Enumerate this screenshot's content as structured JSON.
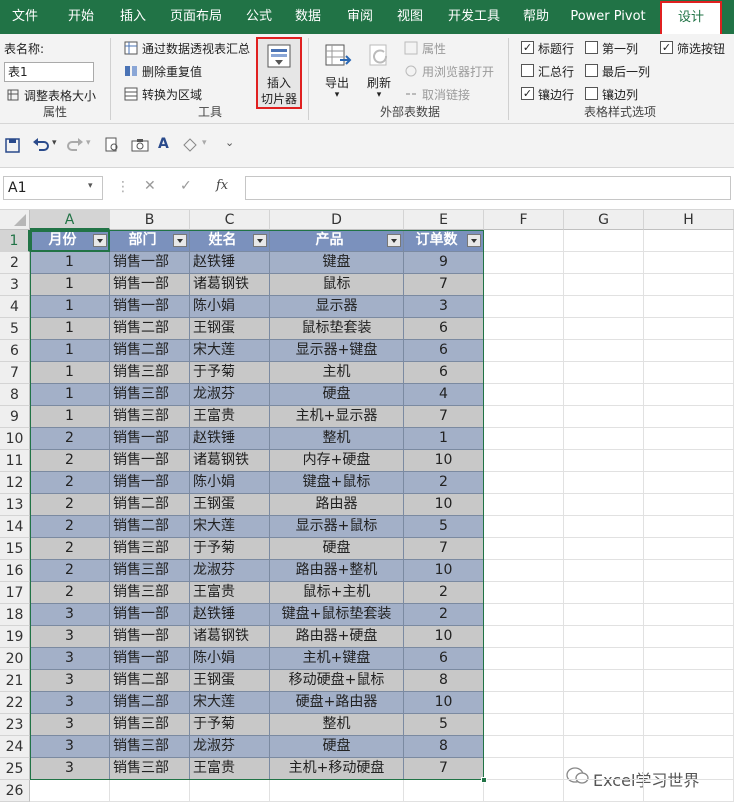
{
  "tabs": [
    "文件",
    "开始",
    "插入",
    "页面布局",
    "公式",
    "数据",
    "审阅",
    "视图",
    "开发工具",
    "帮助",
    "Power Pivot",
    "设计"
  ],
  "active_tab": "设计",
  "ribbon": {
    "properties": {
      "name_label": "表名称:",
      "table_name": "表1",
      "resize": "调整表格大小",
      "group": "属性"
    },
    "tools": {
      "pivot": "通过数据透视表汇总",
      "remove_dup": "删除重复值",
      "convert": "转换为区域",
      "slicer_line1": "插入",
      "slicer_line2": "切片器",
      "group": "工具"
    },
    "external": {
      "export": "导出",
      "refresh": "刷新",
      "properties": "属性",
      "open_browser": "用浏览器打开",
      "unlink": "取消链接",
      "group": "外部表数据"
    },
    "style_options": {
      "items": [
        {
          "label": "标题行",
          "checked": true
        },
        {
          "label": "第一列",
          "checked": false
        },
        {
          "label": "筛选按钮",
          "checked": true
        },
        {
          "label": "汇总行",
          "checked": false
        },
        {
          "label": "最后一列",
          "checked": false
        },
        {
          "label": "镶边行",
          "checked": true
        },
        {
          "label": "镶边列",
          "checked": false
        }
      ],
      "group": "表格样式选项"
    }
  },
  "namebox": "A1",
  "formula_buttons": {
    "cancel": "✕",
    "enter": "✓",
    "fx": "fx"
  },
  "columns": [
    "A",
    "B",
    "C",
    "D",
    "E",
    "F",
    "G",
    "H"
  ],
  "table": {
    "headers": [
      "月份",
      "部门",
      "姓名",
      "产品",
      "订单数"
    ],
    "rows": [
      [
        "1",
        "销售一部",
        "赵铁锤",
        "键盘",
        "9"
      ],
      [
        "1",
        "销售一部",
        "诸葛钢铁",
        "鼠标",
        "7"
      ],
      [
        "1",
        "销售一部",
        "陈小娟",
        "显示器",
        "3"
      ],
      [
        "1",
        "销售二部",
        "王钢蛋",
        "鼠标垫套装",
        "6"
      ],
      [
        "1",
        "销售二部",
        "宋大莲",
        "显示器+键盘",
        "6"
      ],
      [
        "1",
        "销售三部",
        "于予菊",
        "主机",
        "6"
      ],
      [
        "1",
        "销售三部",
        "龙淑芬",
        "硬盘",
        "4"
      ],
      [
        "1",
        "销售三部",
        "王富贵",
        "主机+显示器",
        "7"
      ],
      [
        "2",
        "销售一部",
        "赵铁锤",
        "整机",
        "1"
      ],
      [
        "2",
        "销售一部",
        "诸葛钢铁",
        "内存+硬盘",
        "10"
      ],
      [
        "2",
        "销售一部",
        "陈小娟",
        "键盘+鼠标",
        "2"
      ],
      [
        "2",
        "销售二部",
        "王钢蛋",
        "路由器",
        "10"
      ],
      [
        "2",
        "销售二部",
        "宋大莲",
        "显示器+鼠标",
        "5"
      ],
      [
        "2",
        "销售三部",
        "于予菊",
        "硬盘",
        "7"
      ],
      [
        "2",
        "销售三部",
        "龙淑芬",
        "路由器+整机",
        "10"
      ],
      [
        "2",
        "销售三部",
        "王富贵",
        "鼠标+主机",
        "2"
      ],
      [
        "3",
        "销售一部",
        "赵铁锤",
        "键盘+鼠标垫套装",
        "2"
      ],
      [
        "3",
        "销售一部",
        "诸葛钢铁",
        "路由器+硬盘",
        "10"
      ],
      [
        "3",
        "销售一部",
        "陈小娟",
        "主机+键盘",
        "6"
      ],
      [
        "3",
        "销售二部",
        "王钢蛋",
        "移动硬盘+鼠标",
        "8"
      ],
      [
        "3",
        "销售二部",
        "宋大莲",
        "硬盘+路由器",
        "10"
      ],
      [
        "3",
        "销售三部",
        "于予菊",
        "整机",
        "5"
      ],
      [
        "3",
        "销售三部",
        "龙淑芬",
        "硬盘",
        "8"
      ],
      [
        "3",
        "销售三部",
        "王富贵",
        "主机+移动硬盘",
        "7"
      ]
    ]
  },
  "watermark": "Excel学习世界",
  "colors": {
    "ribbon_green": "#217346",
    "header_fill": "#7b91bd",
    "band_light": "#c8c8c8",
    "band_dark": "#a3b0c8",
    "highlight_red": "#e02020"
  }
}
